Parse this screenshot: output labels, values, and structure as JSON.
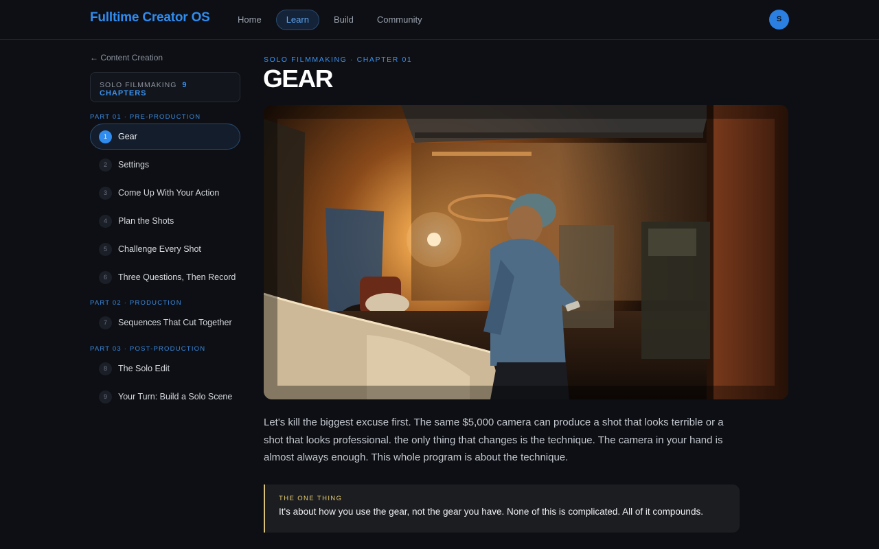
{
  "app": {
    "brand": "Fulltime Creator OS",
    "avatar_initial": "S"
  },
  "nav": {
    "items": [
      {
        "label": "Home",
        "active": false
      },
      {
        "label": "Learn",
        "active": true
      },
      {
        "label": "Build",
        "active": false
      },
      {
        "label": "Community",
        "active": false
      }
    ]
  },
  "sidebar": {
    "back_label": "← Content Creation",
    "course_name": "Solo Filmmaking",
    "course_count": "9 Chapters",
    "parts": [
      {
        "label": "Part 01 · Pre-Production"
      },
      {
        "label": "Part 02 · Production"
      },
      {
        "label": "Part 03 · Post-Production"
      }
    ],
    "chapters": [
      {
        "num": "1",
        "label": "Gear",
        "active": true
      },
      {
        "num": "2",
        "label": "Settings"
      },
      {
        "num": "3",
        "label": "Come Up With Your Action"
      },
      {
        "num": "4",
        "label": "Plan the Shots"
      },
      {
        "num": "5",
        "label": "Challenge Every Shot"
      },
      {
        "num": "6",
        "label": "Three Questions, Then Record"
      },
      {
        "num": "7",
        "label": "Sequences That Cut Together"
      },
      {
        "num": "8",
        "label": "The Solo Edit"
      },
      {
        "num": "9",
        "label": "Your Turn: Build a Solo Scene"
      }
    ]
  },
  "main": {
    "eyebrow": "Solo Filmmaking · Chapter 01",
    "title": "GEAR",
    "body": "Let's kill the biggest excuse first. The same $5,000 camera can produce a shot that looks terrible or a shot that looks professional. the only thing that changes is the technique. The camera in your hand is almost always enough. This whole program is about the technique.",
    "callout": {
      "label": "The One Thing",
      "text": "It's about how you use the gear, not the gear you have. None of this is complicated. All of it compounds."
    }
  },
  "colors": {
    "accent": "#2f8cf0",
    "callout_accent": "#e3ca6e",
    "background": "#0d0f14"
  }
}
